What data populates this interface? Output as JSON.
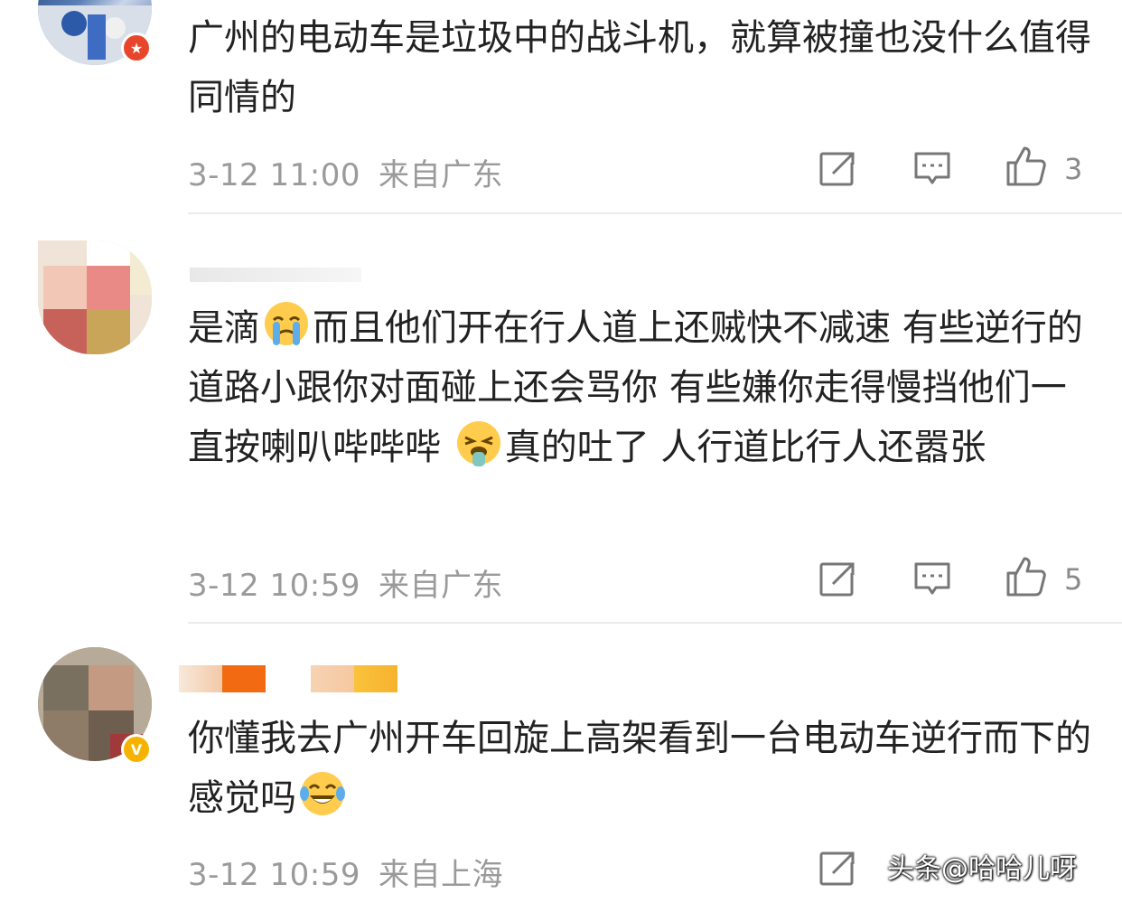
{
  "comments": [
    {
      "text": "广州的电动车是垃圾中的战斗机，就算被撞也没什么值得同情的",
      "date": "3-12 11:00",
      "location": "来自广东",
      "likes": "3",
      "badge_icon": "star-badge-icon"
    },
    {
      "text_parts": [
        "是滴",
        "而且他们开在行人道上还贼快不减速 有些逆行的道路小跟你对面碰上还会骂你 有些嫌你走得慢挡他们一直按喇叭哔哔哔 ",
        "真的吐了 人行道比行人还嚣张"
      ],
      "date": "3-12 10:59",
      "location": "来自广东",
      "likes": "5"
    },
    {
      "text": "你懂我去广州开车回旋上高架看到一台电动车逆行而下的感觉吗",
      "date": "3-12 10:59",
      "location": "来自上海",
      "badge_icon": "verified-badge-icon"
    }
  ],
  "watermark": "头条@哈哈儿呀",
  "colors": {
    "text": "#222222",
    "meta": "#9a9a9a",
    "divider": "#ececec",
    "badge_red": "#e8462c",
    "badge_gold": "#f5b300"
  }
}
